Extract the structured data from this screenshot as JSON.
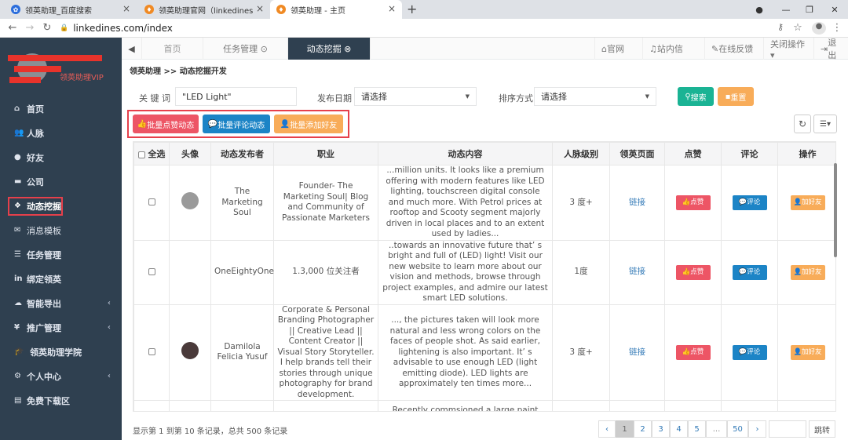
{
  "browser": {
    "tabs": [
      {
        "title": "领英助理_百度搜索"
      },
      {
        "title": "领英助理官网（linkedines.com）"
      },
      {
        "title": "领英助理 - 主页"
      }
    ],
    "new_tab": "+",
    "url": "linkedines.com/index"
  },
  "sidebar": {
    "brand": "领英助理VIP",
    "items": [
      {
        "label": "首页",
        "icon": "home-icon"
      },
      {
        "label": "人脉",
        "icon": "contacts-icon"
      },
      {
        "label": "好友",
        "icon": "chat-icon"
      },
      {
        "label": "公司",
        "icon": "briefcase-icon"
      },
      {
        "label": "动态挖掘",
        "icon": "dig-icon"
      },
      {
        "label": "消息模板",
        "icon": "mail-icon"
      },
      {
        "label": "任务管理",
        "icon": "tasks-icon"
      },
      {
        "label": "绑定领英",
        "icon": "linkedin-icon"
      },
      {
        "label": "智能导出",
        "icon": "cloud-icon"
      },
      {
        "label": "推广管理",
        "icon": "yen-icon"
      },
      {
        "label": "领英助理学院",
        "icon": "graduation-icon"
      },
      {
        "label": "个人中心",
        "icon": "settings-icon"
      },
      {
        "label": "免费下载区",
        "icon": "file-icon"
      }
    ]
  },
  "topnav": {
    "tabs": [
      {
        "label": "首页"
      },
      {
        "label": "任务管理 ⊙"
      },
      {
        "label": "动态挖掘 ⊗"
      }
    ],
    "right": [
      {
        "label": "官网"
      },
      {
        "label": "站内信"
      },
      {
        "label": "在线反馈"
      },
      {
        "label": "关闭操作▾"
      },
      {
        "label": "退出"
      }
    ]
  },
  "breadcrumb": "领英助理  >>  动态挖掘开发",
  "filters": {
    "keyword_label": "关 键 词",
    "keyword_value": "\"LED Light\"",
    "date_label": "发布日期",
    "date_value": "请选择",
    "sort_label": "排序方式",
    "sort_value": "请选择",
    "search": "搜索",
    "reset": "重置"
  },
  "bulk": {
    "like": "批量点赞动态",
    "comment": "批量评论动态",
    "add": "批量添加好友"
  },
  "table": {
    "headers": [
      "全选",
      "头像",
      "动态发布者",
      "职业",
      "动态内容",
      "人脉级别",
      "领英页面",
      "点赞",
      "评论",
      "操作"
    ],
    "rows": [
      {
        "author": "The Marketing Soul",
        "job": "Founder- The Marketing Soul| Blog and Community of Passionate Marketers",
        "content": "...million units. It looks like a premium offering with modern features like LED lighting, touchscreen digital console and much more. With Petrol prices at rooftop and Scooty segment majorly driven in local places and to an extent used by ladies...",
        "level": "3 度+",
        "link": "链接",
        "avatar_color": "#9a9a9a"
      },
      {
        "author": "OneEightyOne",
        "job": "1.3,000 位关注者",
        "content": "..towards an innovative future that’ s bright and full of (LED) light! Visit our new website to learn more about our vision and methods, browse through project examples, and admire our latest smart LED solutions.",
        "level": "1度",
        "link": "链接",
        "avatar_color": ""
      },
      {
        "author": "Damilola Felicia Yusuf",
        "job": "Corporate & Personal Branding Photographer || Creative Lead || Content Creator || Visual Story Storyteller. I help brands tell their stories through unique photography for brand development.",
        "content": "..., the pictures taken will look more natural and less wrong colors on the faces of people shot. As said earlier, lightening is also important. It’ s advisable to use enough LED (light emitting diode). LED lights are approximately ten times more...",
        "level": "3 度+",
        "link": "链接",
        "avatar_color": "#4a3a3a"
      },
      {
        "author": "",
        "job": "",
        "content": "Recently commsioned a large paint booth with lots of lights...",
        "level": "",
        "link": "",
        "avatar_color": ""
      }
    ],
    "like_btn": "点赞",
    "comment_btn": "评论",
    "add_btn": "加好友"
  },
  "footer": {
    "summary": "显示第 1 到第 10 条记录，总共 500 条记录",
    "pages": [
      "‹",
      "1",
      "2",
      "3",
      "4",
      "5",
      "...",
      "50",
      "›"
    ],
    "goto": "跳转"
  },
  "colors": {
    "sidebar": "#2f4050",
    "red": "#ed5565",
    "blue": "#1c84c6",
    "orange": "#f8ac59",
    "green": "#1ab394",
    "highlight": "#e6404b"
  }
}
